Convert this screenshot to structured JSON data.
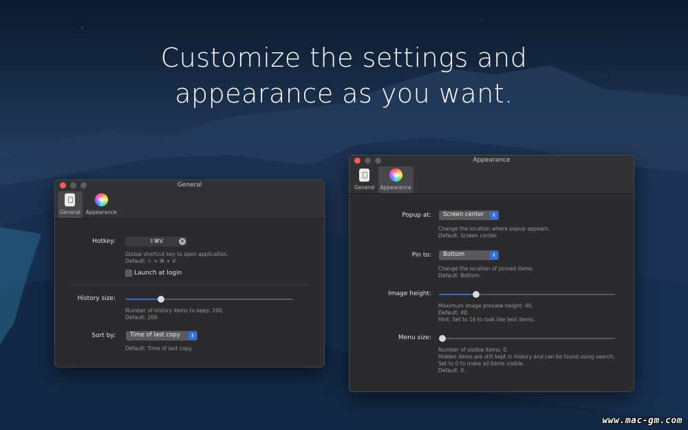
{
  "headline": {
    "line1": "Customize the settings and",
    "line2": "appearance as you want."
  },
  "general_window": {
    "title": "General",
    "tabs": [
      {
        "label": "General",
        "icon": "general-icon",
        "active": true
      },
      {
        "label": "Appearance",
        "icon": "appearance-icon",
        "active": false
      }
    ],
    "hotkey": {
      "label": "Hotkey:",
      "value": "⇧⌘V",
      "help_1": "Global shortcut key to open application.",
      "help_2": "Default: ⇧ + ⌘ + V"
    },
    "launch_at_login": {
      "label": "Launch at login",
      "checked": false
    },
    "history_size": {
      "label": "History size:",
      "value_fraction": 0.21,
      "help_1": "Number of history items to keep: 200.",
      "help_2": "Default: 200."
    },
    "sort_by": {
      "label": "Sort by:",
      "value": "Time of last copy",
      "help_1": "Default: Time of last copy."
    }
  },
  "appearance_window": {
    "title": "Appearance",
    "tabs": [
      {
        "label": "General",
        "icon": "general-icon",
        "active": false
      },
      {
        "label": "Appearance",
        "icon": "appearance-icon",
        "active": true
      }
    ],
    "popup_at": {
      "label": "Popup at:",
      "value": "Screen center",
      "help_1": "Change the location where popup appears.",
      "help_2": "Default: Screen center."
    },
    "pin_to": {
      "label": "Pin to:",
      "value": "Bottom",
      "help_1": "Change the location of pinned items.",
      "help_2": "Default: Bottom."
    },
    "image_height": {
      "label": "Image height:",
      "value_fraction": 0.21,
      "help_1": "Maximum image preview height: 40.",
      "help_2": "Default: 40.",
      "help_3": "Hint: Set to 16 to look like text items."
    },
    "menu_size": {
      "label": "Menu size:",
      "value_fraction": 0.0,
      "help_1": "Number of visible items: 0.",
      "help_2": "Hidden items are still kept in history and can be found using search.",
      "help_3": "Set to 0 to make all items visible.",
      "help_4": "Default: 0."
    }
  },
  "watermark": "www.mac-gm.com",
  "colors": {
    "accent": "#2f6fe0",
    "window_bg": "#2b2b2d",
    "close": "#ec5f57"
  }
}
